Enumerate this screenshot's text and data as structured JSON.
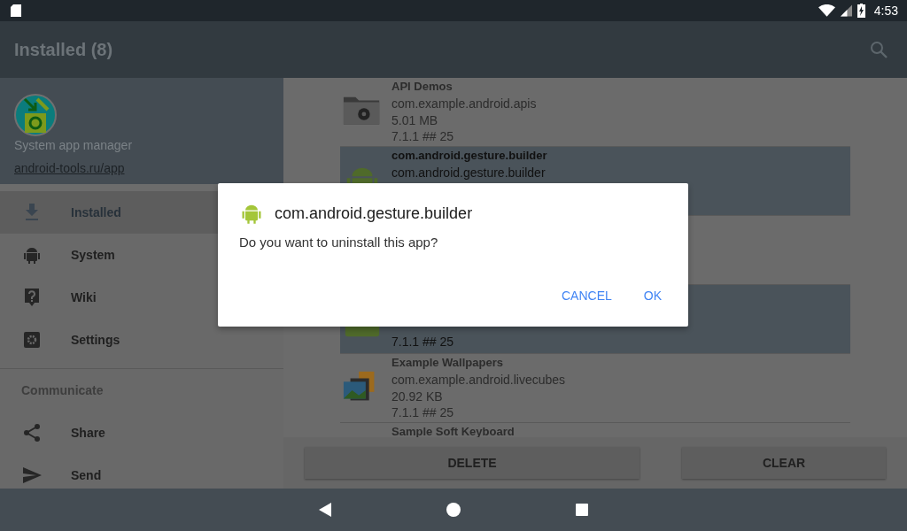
{
  "status_bar": {
    "time": "4:53"
  },
  "app_bar": {
    "title": "Installed (8)"
  },
  "drawer": {
    "app_name": "System app manager",
    "link": "android-tools.ru/app",
    "items": [
      {
        "label": "Installed",
        "selected": true
      },
      {
        "label": "System",
        "selected": false
      },
      {
        "label": "Wiki",
        "selected": false
      },
      {
        "label": "Settings",
        "selected": false
      }
    ],
    "section_title": "Communicate",
    "section_items": [
      {
        "label": "Share",
        "selected": false
      },
      {
        "label": "Send",
        "selected": false
      }
    ]
  },
  "apps": [
    {
      "name": "API Demos",
      "package": "com.example.android.apis",
      "size": "5.01 MB",
      "version": "7.1.1 ## 25",
      "selected": false
    },
    {
      "name": "com.android.gesture.builder",
      "package": "com.android.gesture.builder",
      "selected": true
    },
    {
      "selected": false
    },
    {
      "version": "7.1.1 ## 25",
      "selected": true
    },
    {
      "name": "Example Wallpapers",
      "package": "com.example.android.livecubes",
      "size": "20.92 KB",
      "version": "7.1.1 ## 25",
      "selected": false
    },
    {
      "name": "Sample Soft Keyboard",
      "selected": false
    }
  ],
  "actions": [
    "DELETE",
    "CLEAR"
  ],
  "dialog": {
    "title": "com.android.gesture.builder",
    "message": "Do you want to uninstall this app?",
    "buttons": [
      "CANCEL",
      "OK"
    ]
  }
}
